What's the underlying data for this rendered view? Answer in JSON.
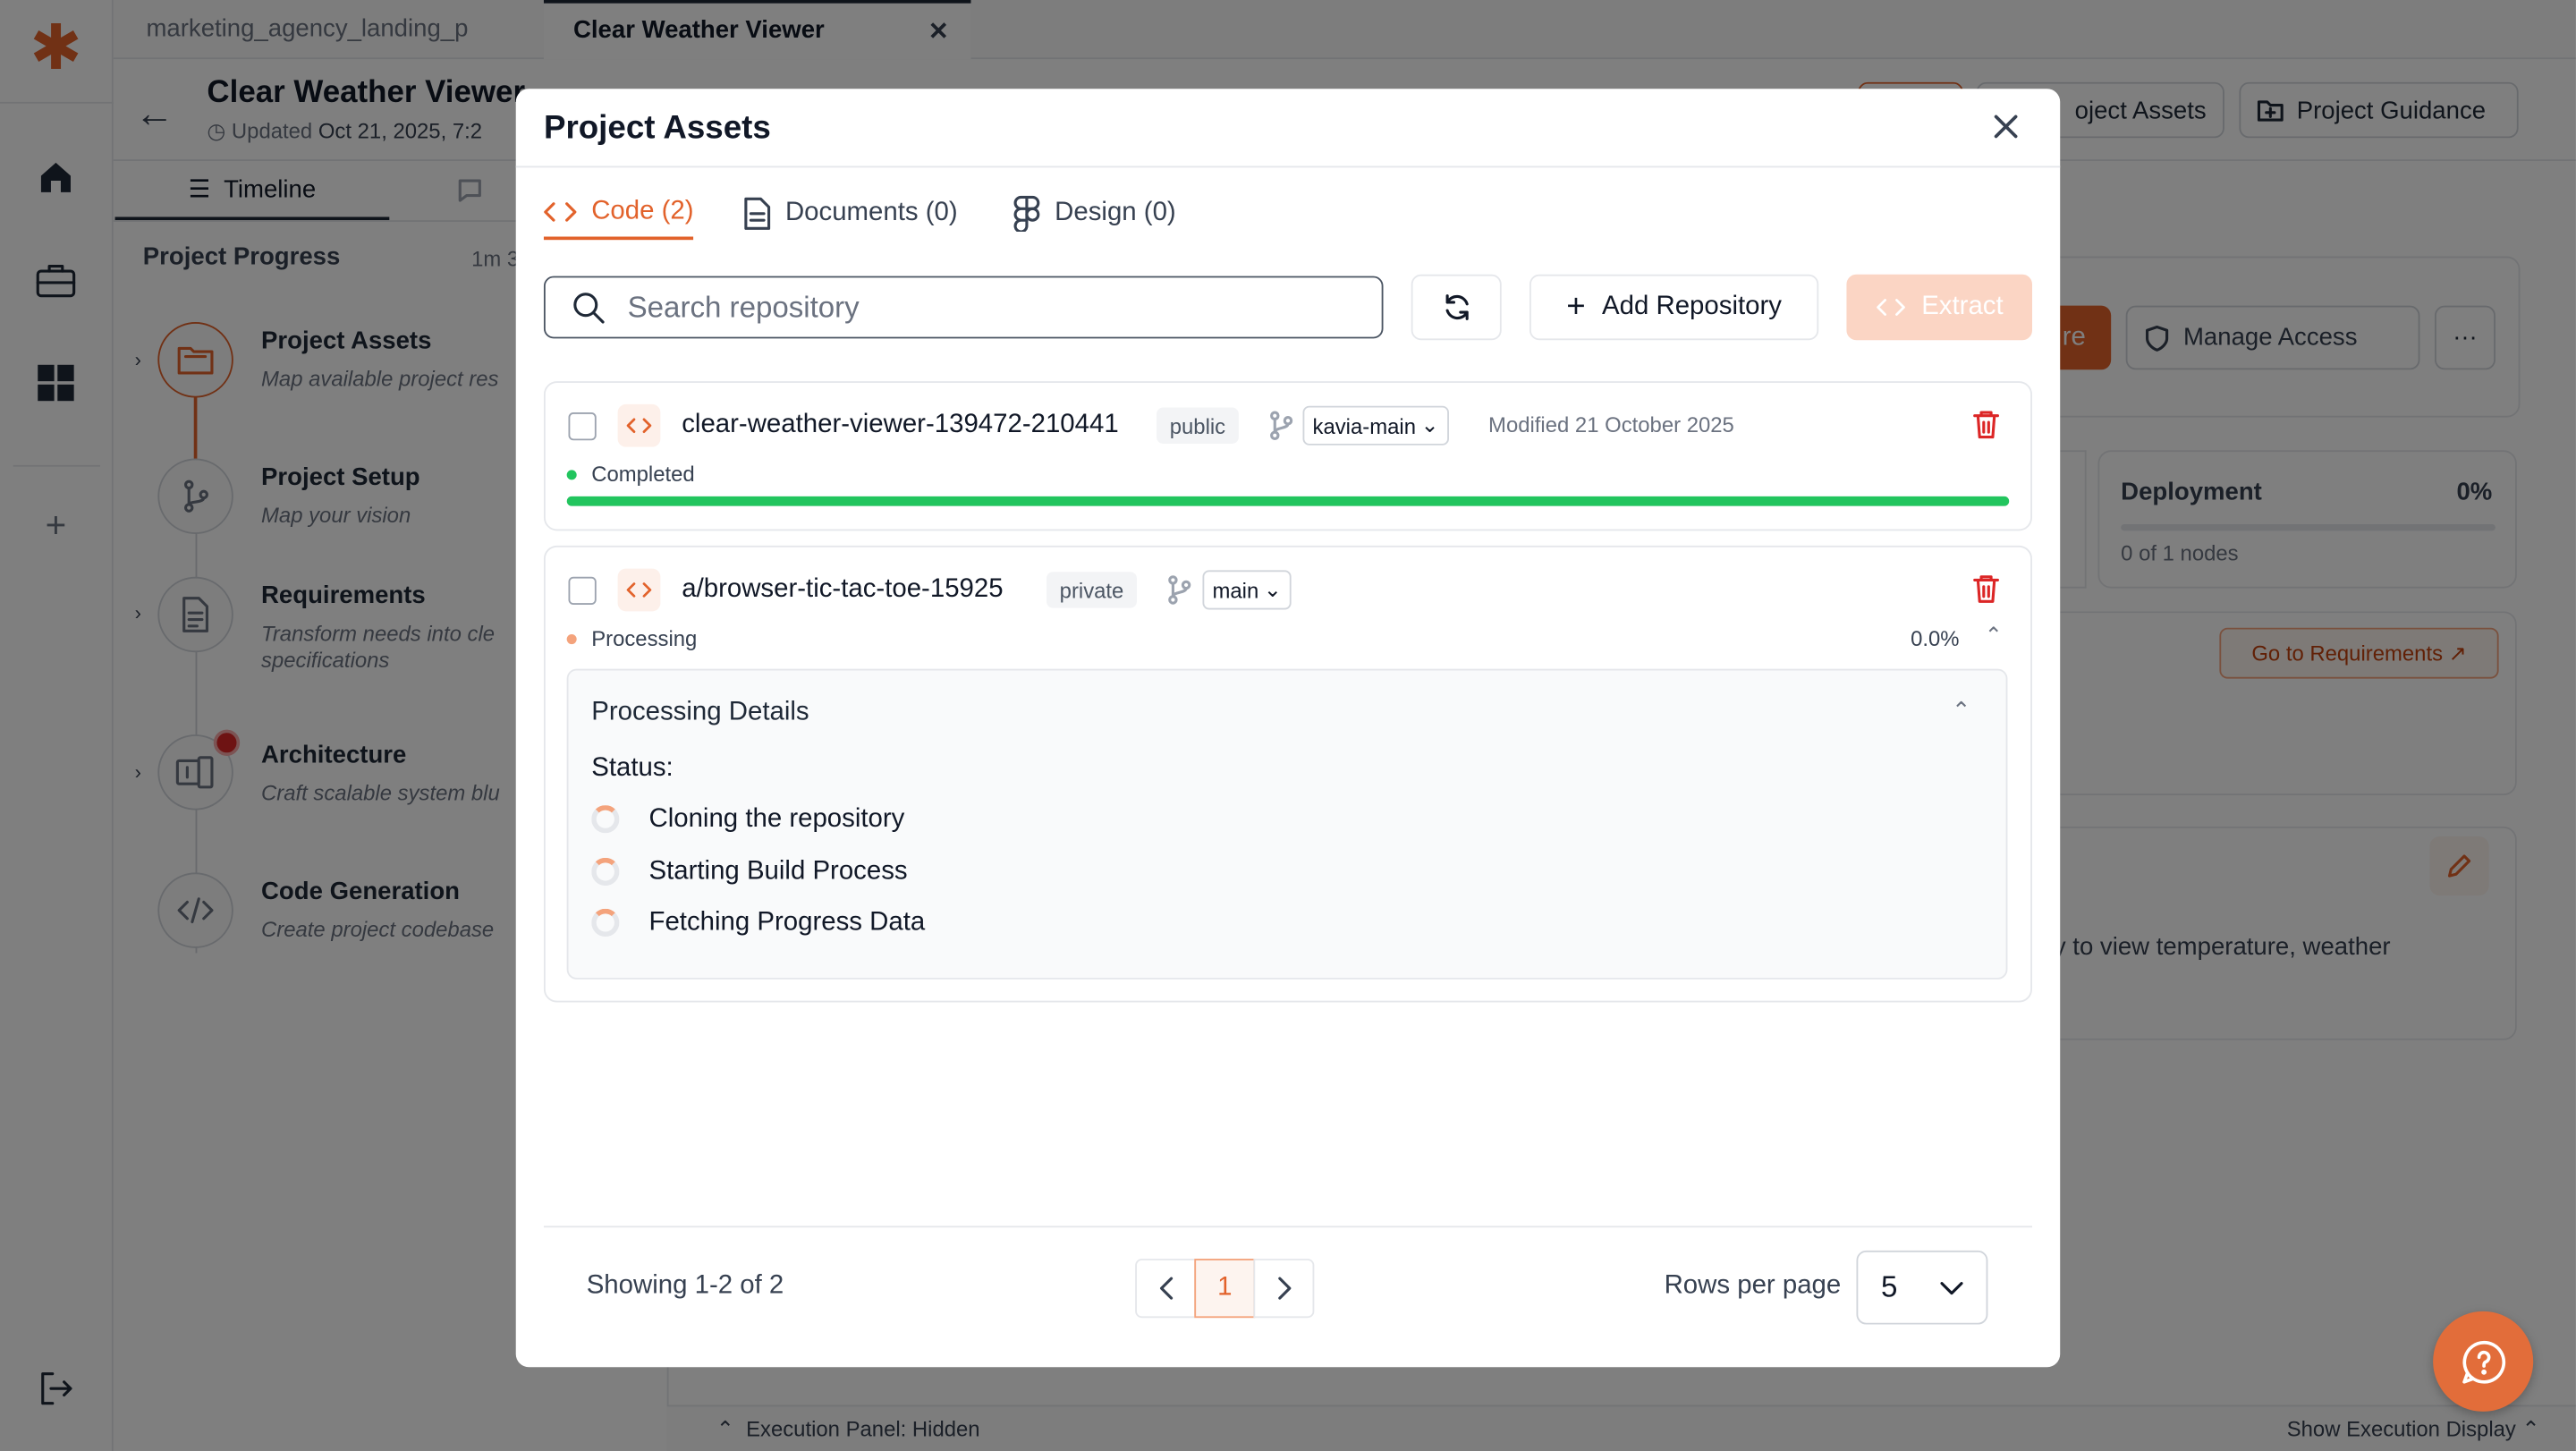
{
  "brand": {
    "logo_glyph": "✱",
    "accent": "#e2622b"
  },
  "tabs": {
    "inactive": "marketing_agency_landing_p",
    "active": "Clear Weather Viewer",
    "close": "✕"
  },
  "header": {
    "back": "←",
    "title": "Clear Weather Viewer",
    "updated_label": "Updated",
    "updated_value": "Oct 21, 2025, 7:2",
    "buttons": [
      "oject Assets",
      "Project Guidance"
    ]
  },
  "sidebar": {
    "timeline_tab": "Timeline",
    "progress_title": "Project Progress",
    "progress_time": "1m 3"
  },
  "steps": [
    {
      "title": "Project Assets",
      "desc": "Map available project res"
    },
    {
      "title": "Project Setup",
      "desc": "Map your vision"
    },
    {
      "title": "Requirements",
      "desc": "Transform needs into cle specifications"
    },
    {
      "title": "Architecture",
      "desc": "Craft scalable system blu"
    },
    {
      "title": "Code Generation",
      "desc": "Create project codebase"
    }
  ],
  "background": {
    "partial_btn": "re",
    "manage_access": "Manage Access",
    "more": "···",
    "deployment": {
      "label": "Deployment",
      "percent": "0%",
      "nodes": "0 of 1 nodes"
    },
    "go_requirements": "Go to Requirements ↗",
    "desc_fragment": "y to view temperature, weather",
    "execution_panel": "Execution Panel: Hidden",
    "show_execution": "Show Execution Display"
  },
  "modal": {
    "title": "Project Assets",
    "tabs": [
      {
        "label": "Code (2)",
        "active": true
      },
      {
        "label": "Documents (0)",
        "active": false
      },
      {
        "label": "Design (0)",
        "active": false
      }
    ],
    "search_placeholder": "Search repository",
    "add_repo": "Add Repository",
    "extract": "Extract",
    "repos": [
      {
        "name": "clear-weather-viewer-139472-210441",
        "visibility": "public",
        "branch": "kavia-main",
        "modified": "Modified 21 October 2025",
        "status": "Completed",
        "status_color": "#22c55e",
        "progress": 1.0
      },
      {
        "name": "a/browser-tic-tac-toe-15925",
        "visibility": "private",
        "branch": "main",
        "status": "Processing",
        "status_color": "#f4a37c",
        "percent": "0.0%",
        "details": {
          "title": "Processing Details",
          "status_label": "Status:",
          "steps": [
            "Cloning the repository",
            "Starting Build Process",
            "Fetching Progress Data"
          ]
        }
      }
    ],
    "footer": {
      "showing": "Showing 1-2 of 2",
      "page": "1",
      "rows_label": "Rows per page",
      "rows_value": "5"
    }
  }
}
